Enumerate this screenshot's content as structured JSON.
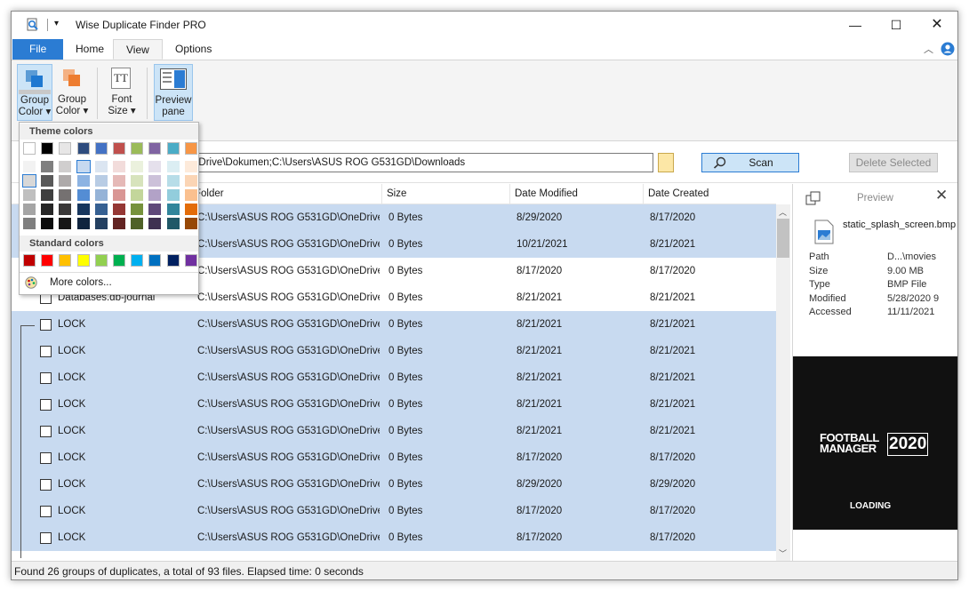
{
  "app": {
    "title": "Wise Duplicate Finder PRO",
    "tabs": [
      {
        "label": "File"
      },
      {
        "label": "Home"
      },
      {
        "label": "View"
      },
      {
        "label": "Options"
      }
    ]
  },
  "ribbon": {
    "buttons": [
      {
        "line1": "Group",
        "line2": "Color ▾"
      },
      {
        "line1": "Group",
        "line2": "Color ▾"
      },
      {
        "line1": "Font",
        "line2": "Size ▾"
      },
      {
        "line1": "Preview",
        "line2": "pane"
      }
    ]
  },
  "toolbar": {
    "path": "eDrive\\Dokumen;C:\\Users\\ASUS ROG G531GD\\Downloads",
    "scan_label": "Scan",
    "delete_label": "Delete Selected"
  },
  "grid": {
    "columns": [
      "Folder",
      "Size",
      "Date Modified",
      "Date Created"
    ],
    "rows": [
      {
        "name": "",
        "folder": "C:\\Users\\ASUS ROG G531GD\\OneDrive...",
        "size": "0 Bytes",
        "modified": "8/29/2020",
        "created": "8/17/2020"
      },
      {
        "name": "",
        "folder": "C:\\Users\\ASUS ROG G531GD\\OneDrive...",
        "size": "0 Bytes",
        "modified": "10/21/2021",
        "created": "8/21/2021"
      },
      {
        "name": "",
        "folder": "C:\\Users\\ASUS ROG G531GD\\OneDrive...",
        "size": "0 Bytes",
        "modified": "8/17/2020",
        "created": "8/17/2020"
      },
      {
        "name": "Databases.db-journal",
        "folder": "C:\\Users\\ASUS ROG G531GD\\OneDrive...",
        "size": "0 Bytes",
        "modified": "8/21/2021",
        "created": "8/21/2021"
      },
      {
        "name": "LOCK",
        "folder": "C:\\Users\\ASUS ROG G531GD\\OneDrive...",
        "size": "0 Bytes",
        "modified": "8/21/2021",
        "created": "8/21/2021"
      },
      {
        "name": "LOCK",
        "folder": "C:\\Users\\ASUS ROG G531GD\\OneDrive...",
        "size": "0 Bytes",
        "modified": "8/21/2021",
        "created": "8/21/2021"
      },
      {
        "name": "LOCK",
        "folder": "C:\\Users\\ASUS ROG G531GD\\OneDrive...",
        "size": "0 Bytes",
        "modified": "8/21/2021",
        "created": "8/21/2021"
      },
      {
        "name": "LOCK",
        "folder": "C:\\Users\\ASUS ROG G531GD\\OneDrive...",
        "size": "0 Bytes",
        "modified": "8/21/2021",
        "created": "8/21/2021"
      },
      {
        "name": "LOCK",
        "folder": "C:\\Users\\ASUS ROG G531GD\\OneDrive...",
        "size": "0 Bytes",
        "modified": "8/21/2021",
        "created": "8/21/2021"
      },
      {
        "name": "LOCK",
        "folder": "C:\\Users\\ASUS ROG G531GD\\OneDrive...",
        "size": "0 Bytes",
        "modified": "8/17/2020",
        "created": "8/17/2020"
      },
      {
        "name": "LOCK",
        "folder": "C:\\Users\\ASUS ROG G531GD\\OneDrive...",
        "size": "0 Bytes",
        "modified": "8/29/2020",
        "created": "8/29/2020"
      },
      {
        "name": "LOCK",
        "folder": "C:\\Users\\ASUS ROG G531GD\\OneDrive...",
        "size": "0 Bytes",
        "modified": "8/17/2020",
        "created": "8/17/2020"
      },
      {
        "name": "LOCK",
        "folder": "C:\\Users\\ASUS ROG G531GD\\OneDrive...",
        "size": "0 Bytes",
        "modified": "8/17/2020",
        "created": "8/17/2020"
      }
    ]
  },
  "preview": {
    "title": "Preview",
    "filename": "static_splash_screen.bmp",
    "labels": [
      "Path",
      "Size",
      "Type",
      "Modified",
      "Accessed"
    ],
    "values": [
      "D...\\movies",
      "9.00 MB",
      "BMP File",
      "5/28/2020 9",
      "11/11/2021"
    ],
    "image_line1": "FOOTBALL",
    "image_line2": "MANAGER",
    "image_year": "2020",
    "image_caption": "LOADING"
  },
  "status": "Found 26 groups of duplicates, a total of 93 files. Elapsed time: 0 seconds",
  "color_popup": {
    "theme_title": "Theme colors",
    "standard_title": "Standard colors",
    "more_label": "More colors...",
    "theme_top": [
      "#ffffff",
      "#000000",
      "#e7e6e6",
      "#2e4c7e",
      "#4472c4",
      "#c0504d",
      "#9bbb59",
      "#8064a2",
      "#4bacc6",
      "#f79646"
    ],
    "theme_cols": [
      [
        "#f2f2f2",
        "#d8d8d8",
        "#bfbfbf",
        "#a5a5a5",
        "#7f7f7f"
      ],
      [
        "#7f7f7f",
        "#595959",
        "#3f3f3f",
        "#262626",
        "#0c0c0c"
      ],
      [
        "#d0cece",
        "#aeaaaa",
        "#757171",
        "#3a3838",
        "#171616"
      ],
      [
        "#c6d9f0",
        "#8db3e2",
        "#548dd4",
        "#17365d",
        "#0f243e"
      ],
      [
        "#dbe5f1",
        "#b8cce4",
        "#95b3d7",
        "#366092",
        "#244061"
      ],
      [
        "#f2dcdb",
        "#e5b9b7",
        "#d99694",
        "#953734",
        "#632423"
      ],
      [
        "#ebf1dd",
        "#d7e3bc",
        "#c3d69b",
        "#76923c",
        "#4f6128"
      ],
      [
        "#e5e0ec",
        "#ccc1d9",
        "#b2a2c7",
        "#5f497a",
        "#3f3151"
      ],
      [
        "#dbeef3",
        "#b7dde8",
        "#92cddc",
        "#31859b",
        "#205867"
      ],
      [
        "#fdeada",
        "#fbd5b5",
        "#fac08f",
        "#e36c09",
        "#974806"
      ]
    ],
    "standard": [
      "#c00000",
      "#ff0000",
      "#ffc000",
      "#ffff00",
      "#92d050",
      "#00b050",
      "#00b0f0",
      "#0070c0",
      "#002060",
      "#7030a0"
    ]
  }
}
